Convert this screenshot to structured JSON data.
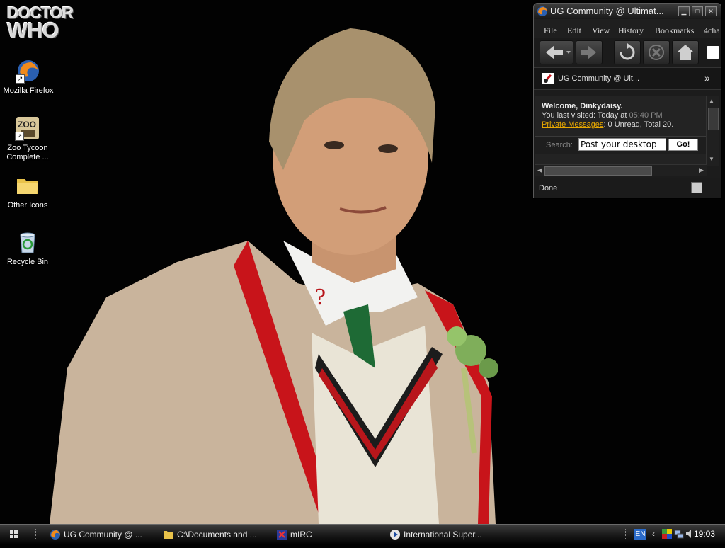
{
  "desktop": {
    "logo": {
      "line1": "DOCTOR",
      "line2": "WHO"
    },
    "icons": [
      {
        "label": "Mozilla Firefox",
        "icon": "firefox-icon"
      },
      {
        "label": "Zoo Tycoon Complete ...",
        "icon": "zoo-tycoon-icon"
      },
      {
        "label": "Other Icons",
        "icon": "folder-icon"
      },
      {
        "label": "Recycle Bin",
        "icon": "recycle-bin-icon"
      }
    ]
  },
  "browser": {
    "title": "UG Community @ Ultimat...",
    "menu": [
      "File",
      "Edit",
      "View",
      "History",
      "Bookmarks",
      "4cha"
    ],
    "toolbar": [
      "back-icon",
      "forward-icon",
      "reload-icon",
      "stop-icon",
      "home-icon"
    ],
    "tab_title": "UG Community @ Ult...",
    "overflow": "»",
    "welcome": {
      "greeting": "Welcome, Dinkydaisy.",
      "last_visited_prefix": "You last visited: Today at",
      "last_visited_time": "05:40 PM",
      "pm_link": "Private Messages",
      "pm_summary": ": 0 Unread, Total 20."
    },
    "search": {
      "label": "Search:",
      "value": "Post your desktop",
      "button": "Go!"
    },
    "status": "Done",
    "colors": {
      "link": "#e8a800",
      "time": "#888888"
    }
  },
  "taskbar": {
    "tasks": [
      {
        "label": "UG Community @ ...",
        "icon": "firefox-icon"
      },
      {
        "label": "C:\\Documents and ...",
        "icon": "folder-icon"
      },
      {
        "label": "mIRC",
        "icon": "mirc-icon"
      },
      {
        "label": "International Super...",
        "icon": "media-player-icon"
      }
    ],
    "language": "EN",
    "clock": "19:03"
  }
}
